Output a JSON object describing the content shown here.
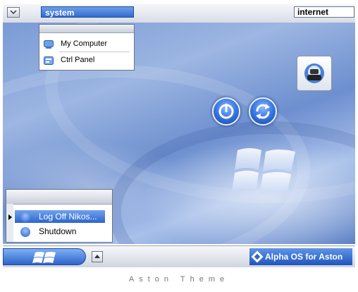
{
  "top_bar": {
    "system_label": "system",
    "internet_label": "internet"
  },
  "system_menu": {
    "items": [
      {
        "label": "My Computer",
        "icon": "computer-icon"
      },
      {
        "label": "Ctrl Panel",
        "icon": "control-panel-icon"
      }
    ]
  },
  "desktop": {
    "widgets": [
      "phone-icon",
      "power-icon",
      "restart-icon",
      "windows-logo"
    ]
  },
  "start_menu": {
    "items": [
      {
        "label": "Log Off Nikos...",
        "icon": "logoff-icon",
        "selected": true
      },
      {
        "label": "Shutdown",
        "icon": "shutdown-icon",
        "selected": false
      }
    ]
  },
  "taskbar": {
    "brand_label": "Alpha OS for Aston"
  },
  "caption": "Aston Theme",
  "colors": {
    "accent": "#2f6bd1",
    "desktop": "#7a9bd6",
    "highlight": "#4f86e0"
  }
}
